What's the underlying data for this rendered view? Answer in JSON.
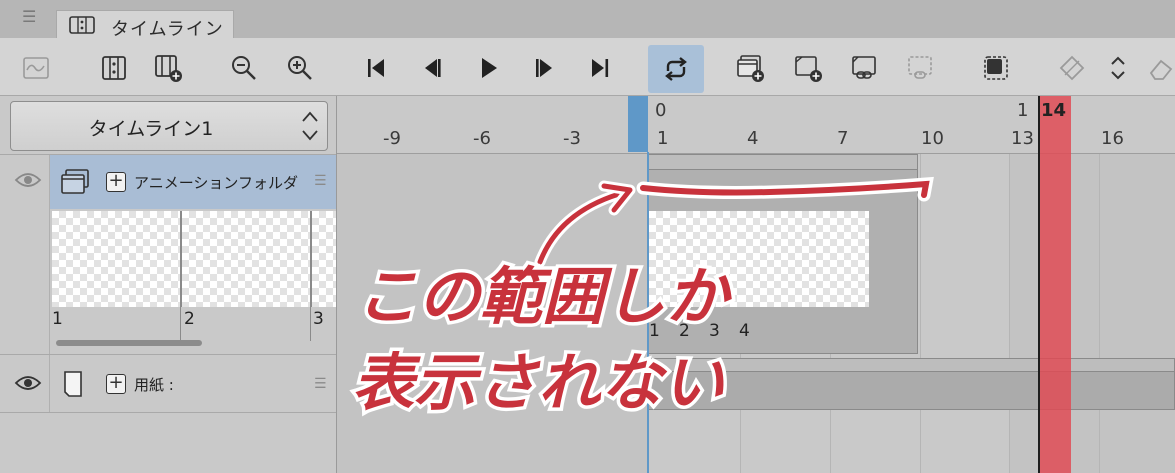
{
  "tab": {
    "title": "タイムライン"
  },
  "timeline_select": {
    "value": "タイムライン1"
  },
  "layers": [
    {
      "name": "アニメーションフォルダ",
      "thumb_numbers": [
        "1",
        "2",
        "3"
      ]
    },
    {
      "name": "用紙 :"
    }
  ],
  "ruler": {
    "top_labels": [
      "0",
      "1",
      "14"
    ],
    "ticks": [
      "-9",
      "-6",
      "-3",
      "1",
      "4",
      "7",
      "10",
      "13",
      "16"
    ]
  },
  "cel_numbers": [
    "1",
    "2",
    "3",
    "4"
  ],
  "annotation": {
    "line1": "この範囲しか",
    "line2": "表示されない"
  },
  "colors": {
    "playhead": "#e24852",
    "selection": "#a9bdd5",
    "accent": "#5f98c8",
    "annotation": "#c8323c"
  }
}
